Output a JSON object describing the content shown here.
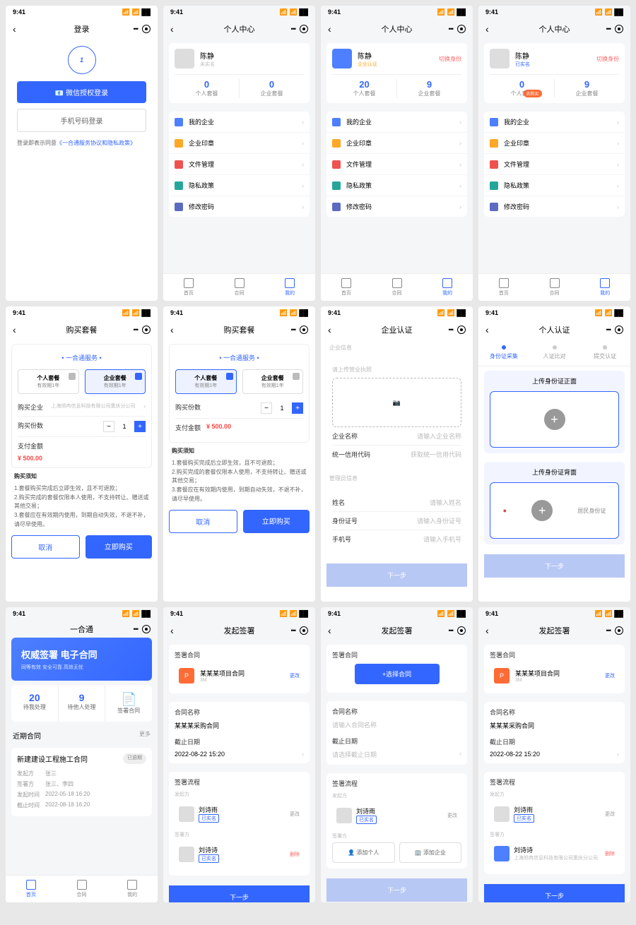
{
  "common": {
    "time": "9:41",
    "dots": "•••",
    "back": "‹",
    "chev": "›"
  },
  "s1": {
    "title": "登录",
    "btn_wechat": "微信授权登录",
    "btn_phone": "手机号码登录",
    "agree_prefix": "登录即表示同意",
    "agree_link": "《一合通服务协议和隐私政策》"
  },
  "profile": {
    "title": "个人中心",
    "name": "陈静",
    "unverified": "未实名",
    "verified_company": "企业认证",
    "verified_personal": "已实名",
    "switch": "切换身份",
    "stat1": "个人套餐",
    "stat2": "企业套餐",
    "menu": [
      "我的企业",
      "企业印章",
      "文件管理",
      "隐私政策",
      "修改密码"
    ],
    "tabs": [
      "首页",
      "合同",
      "我的"
    ]
  },
  "s2": {
    "n1": "0",
    "n2": "0"
  },
  "s3": {
    "n1": "20",
    "n2": "9"
  },
  "s4": {
    "n1": "0",
    "n2": "9",
    "tag": "去购买"
  },
  "buy": {
    "title": "购买套餐",
    "brand": "一合通",
    "brand_suffix": "服务",
    "pkg_personal": "个人套餐",
    "pkg_company": "企业套餐",
    "period": "有效期1年",
    "company_label": "购买企业",
    "company_val": "上海旭冉信息科技有限公司重庆分公司",
    "qty_label": "购买份数",
    "amount_label": "支付金额",
    "amount": "¥ 500.00",
    "notice_h": "购买须知",
    "notice1": "1.套餐购买完成后立即生效，且不可退款；",
    "notice2": "2.购买完成的套餐仅限本人使用，不支持转让、赠送或其他交易；",
    "notice3": "3.套餐应在有效期内使用，到期自动失效，不退不补，请尽早使用。",
    "cancel": "取消",
    "confirm": "立即购买",
    "qty": "1"
  },
  "s7": {
    "title": "企业认证",
    "sec1": "企业信息",
    "upload_hint": "请上传营业执照",
    "name_label": "企业名称",
    "name_ph": "请输入企业名称",
    "code_label": "统一信用代码",
    "code_ph": "获取统一信用代码",
    "sec2": "管理员信息",
    "mgr_name": "姓名",
    "mgr_name_ph": "请输入姓名",
    "mgr_id": "身份证号",
    "mgr_id_ph": "请输入身份证号",
    "mgr_phone": "手机号",
    "mgr_phone_ph": "请输入手机号",
    "next": "下一步"
  },
  "s8": {
    "title": "个人认证",
    "step1": "身份证采集",
    "step2": "人证比对",
    "step3": "提交认证",
    "front": "上传身份证正面",
    "back": "上传身份证背面",
    "idcard": "居民身份证",
    "next": "下一步"
  },
  "home": {
    "title": "一合通",
    "hero_t": "权威签署 电子合同",
    "hero_s": "同等有效 安全可靠 高效无忧",
    "d1_n": "20",
    "d1_l": "待我处理",
    "d2_n": "9",
    "d2_l": "待他人处理",
    "d3_l": "签署合同",
    "recent": "近期合同",
    "more": "更多",
    "c_name": "新建建设工程施工合同",
    "c_status": "已逾期",
    "f1": "发起方",
    "v1": "张三",
    "f2": "签署方",
    "v2": "张三、李四",
    "f3": "发起时间",
    "v3": "2022-05-18 16:20",
    "f4": "截止时间",
    "v4": "2022-08-18 16:20"
  },
  "sign": {
    "title": "发起签署",
    "sec_contract": "签署合同",
    "doc_name": "某某某项目合同",
    "doc_size": "3M",
    "edit": "更改",
    "select_contract": "+选择合同",
    "sec_name": "合同名称",
    "name_val": "某某某采购合同",
    "name_ph": "请输入合同名称",
    "sec_deadline": "截止日期",
    "deadline_val": "2022-08-22 15:20",
    "deadline_ph": "请选择截止日期",
    "sec_flow": "签署流程",
    "role_sender": "发起方",
    "role_signer": "签署方",
    "p1": "刘诗雨",
    "p2": "刘诗诗",
    "tag_personal": "已实名",
    "add_person": "添加个人",
    "add_company": "添加企业",
    "del": "删除",
    "company_sub": "上海旭冉信息科技有限公司重庆分公司",
    "next": "下一步"
  }
}
